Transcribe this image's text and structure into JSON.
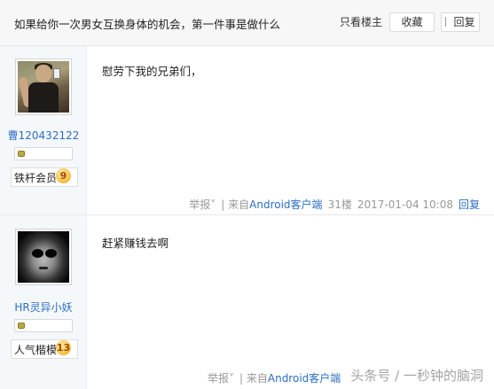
{
  "thread": {
    "title": "如果给你一次男女互换身体的机会，第一件事是做什么",
    "only_op_label": "只看楼主",
    "favorite_label": "收藏",
    "reply_label": "回复"
  },
  "posts": [
    {
      "username": "曹120432122",
      "badge_text": "铁杆会员",
      "badge_level": "9",
      "content": "慰劳下我的兄弟们，",
      "report_label": "举报˅",
      "source_prefix": "| 来自",
      "source_app": "Android客户端",
      "floor": "31楼",
      "time": "2017-01-04 10:08",
      "reply_label": "回复"
    },
    {
      "username": "HR灵异小妖",
      "badge_text": "人气楷模",
      "badge_level": "13",
      "content": "赶紧赚钱去啊",
      "report_label": "举报˅",
      "source_prefix": "| 来自",
      "source_app": "Android客户端",
      "floor": "",
      "time": "",
      "reply_label": ""
    }
  ],
  "watermark": "头条号 / 一秒钟的脑洞",
  "colors": {
    "link": "#2c6ec4",
    "sidebar_bg": "#f5f8fb",
    "topbar_bg": "#f7f7f7"
  },
  "icons": {
    "reply": "reply-icon",
    "level_gem": "level-gem-icon",
    "report_dropdown": "chevron-down-icon"
  }
}
